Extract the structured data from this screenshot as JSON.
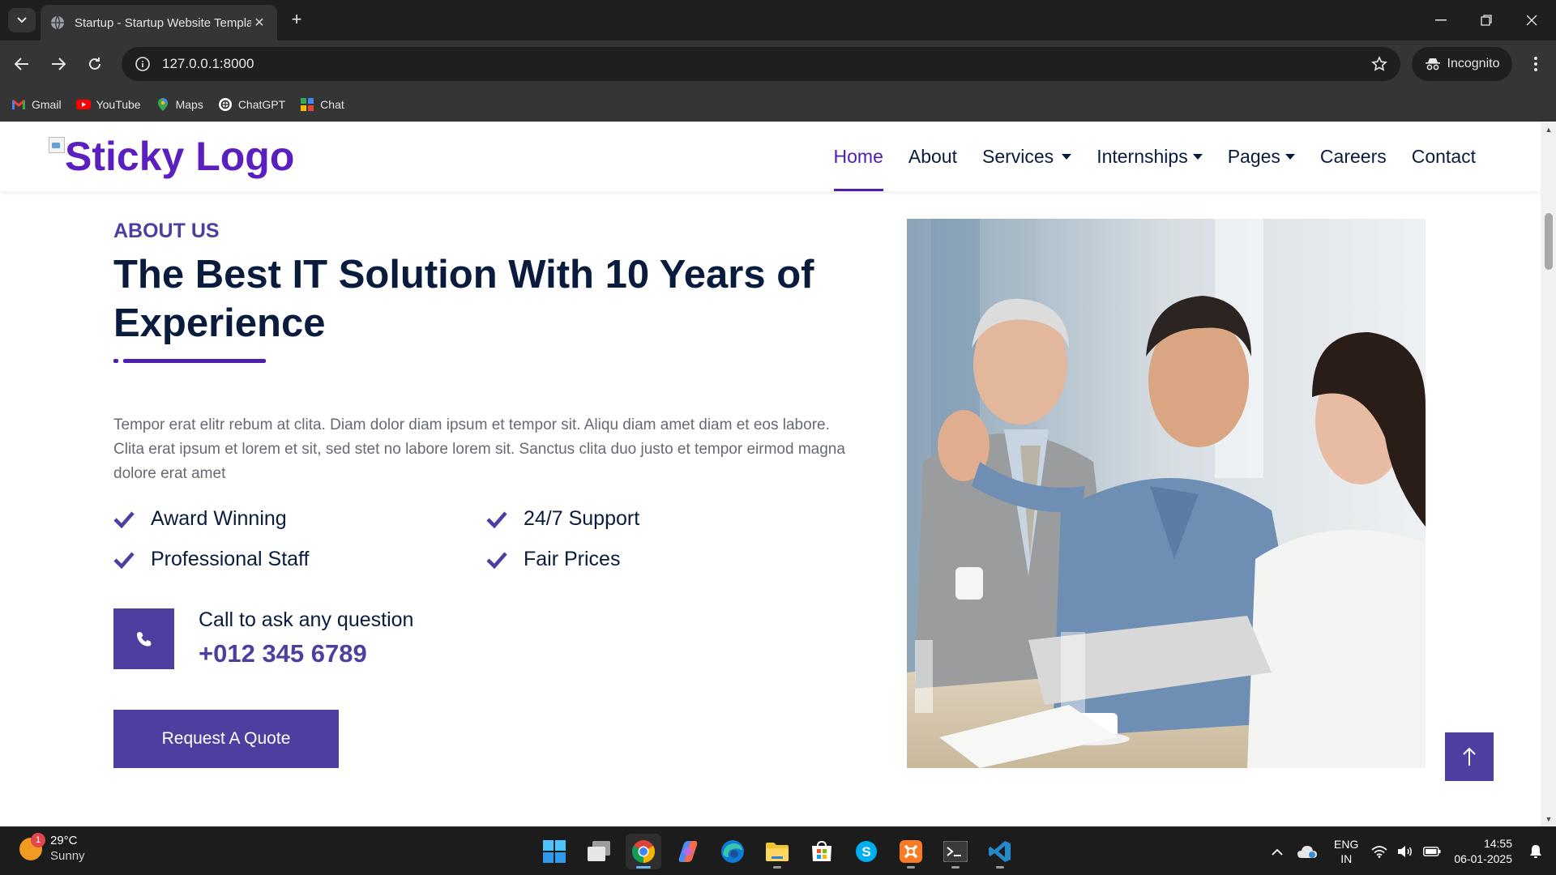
{
  "browser": {
    "tab_title": "Startup - Startup Website Template",
    "url": "127.0.0.1:8000",
    "incognito_label": "Incognito",
    "bookmarks": [
      {
        "label": "Gmail",
        "icon": "gmail-icon"
      },
      {
        "label": "YouTube",
        "icon": "youtube-icon"
      },
      {
        "label": "Maps",
        "icon": "maps-icon"
      },
      {
        "label": "ChatGPT",
        "icon": "chatgpt-icon"
      },
      {
        "label": "Chat",
        "icon": "chat-icon"
      }
    ]
  },
  "site": {
    "logo_text": "Sticky Logo",
    "nav": [
      {
        "label": "Home",
        "active": true,
        "dropdown": false
      },
      {
        "label": "About",
        "active": false,
        "dropdown": false
      },
      {
        "label": "Services",
        "active": false,
        "dropdown": true
      },
      {
        "label": "Internships",
        "active": false,
        "dropdown": true
      },
      {
        "label": "Pages",
        "active": false,
        "dropdown": true
      },
      {
        "label": "Careers",
        "active": false,
        "dropdown": false
      },
      {
        "label": "Contact",
        "active": false,
        "dropdown": false
      }
    ],
    "about": {
      "eyebrow": "ABOUT US",
      "title": "The Best IT Solution With 10 Years of Experience",
      "body": "Tempor erat elitr rebum at clita. Diam dolor diam ipsum et tempor sit. Aliqu diam amet diam et eos labore. Clita erat ipsum et lorem et sit, sed stet no labore lorem sit. Sanctus clita duo justo et tempor eirmod magna dolore erat amet",
      "features": [
        "Award Winning",
        "24/7 Support",
        "Professional Staff",
        "Fair Prices"
      ],
      "call_label": "Call to ask any question",
      "call_number": "+012 345 6789",
      "quote_button": "Request A Quote"
    },
    "colors": {
      "primary": "#4d3fa0",
      "logo": "#5b1fbf",
      "heading": "#091c3e"
    }
  },
  "taskbar": {
    "weather_badge": "1",
    "temperature": "29°C",
    "condition": "Sunny",
    "lang_top": "ENG",
    "lang_bottom": "IN",
    "time": "14:55",
    "date": "06-01-2025"
  }
}
